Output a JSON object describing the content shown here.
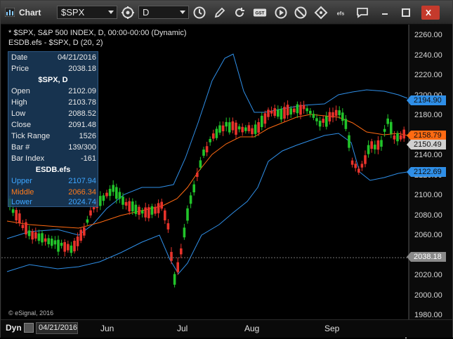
{
  "window": {
    "title": "Chart",
    "symbol_value": "$SPX",
    "interval_value": "D"
  },
  "toolbar": {
    "icons": [
      "link-icon",
      "clock-icon",
      "pencil-icon",
      "refresh-icon",
      "gst-icon",
      "play-icon",
      "no-entry-icon",
      "diamond-tag-icon",
      "efs-icon",
      "comment-icon"
    ],
    "gst_label": "GST",
    "efs_label": "efs"
  },
  "legend": {
    "line1": "* $SPX, S&P 500 INDEX, D, 00:00-00:00 (Dynamic)",
    "line2": "ESDB.efs - $SPX, D (20, 2)"
  },
  "cursor_window": {
    "date_label": "Date",
    "date_value": "04/21/2016",
    "price_label": "Price",
    "price_value": "2038.18",
    "heading": "$SPX, D",
    "open_label": "Open",
    "open_value": "2102.09",
    "high_label": "High",
    "high_value": "2103.78",
    "low_label": "Low",
    "low_value": "2088.52",
    "close_label": "Close",
    "close_value": "2091.48",
    "tick_range_label": "Tick Range",
    "tick_range_value": "1526",
    "bar_num_label": "Bar #",
    "bar_num_value": "139/300",
    "bar_index_label": "Bar Index",
    "bar_index_value": "-161",
    "study_heading": "ESDB.efs",
    "upper_label": "Upper",
    "upper_value": "2107.94",
    "middle_label": "Middle",
    "middle_value": "2066.34",
    "lower_label": "Lower",
    "lower_value": "2024.74"
  },
  "price_axis": {
    "ticks": [
      "2260.00",
      "2240.00",
      "2220.00",
      "2200.00",
      "2180.00",
      "2160.00",
      "2140.00",
      "2120.00",
      "2100.00",
      "2080.00",
      "2060.00",
      "2040.00",
      "2020.00",
      "2000.00",
      "1980.00"
    ],
    "tag_upper": "2194.90",
    "tag_middle": "2158.79",
    "tag_last": "2150.49",
    "tag_lower": "2122.69",
    "tag_cursor": "2038.18"
  },
  "colors": {
    "upper_band": "#2f8fe8",
    "middle_band": "#ff6a12",
    "lower_band": "#2f8fe8",
    "candle_up": "#22c42a",
    "candle_down": "#e8332b"
  },
  "copyright": "© eSignal, 2016",
  "bottom": {
    "mode_label": "Dyn",
    "date_value": "04/21/2016",
    "months": [
      "Jun",
      "Jul",
      "Aug",
      "Sep"
    ]
  }
}
